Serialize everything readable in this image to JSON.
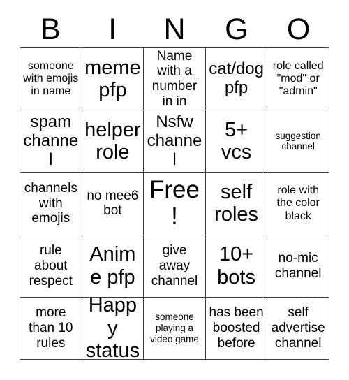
{
  "card": {
    "header_letters": [
      "B",
      "I",
      "N",
      "G",
      "O"
    ],
    "rows": [
      [
        {
          "text": "someone with emojis in name",
          "size": "s"
        },
        {
          "text": "meme pfp",
          "size": "xl"
        },
        {
          "text": "Name with a number in in",
          "size": "m"
        },
        {
          "text": "cat/dog pfp",
          "size": "l"
        },
        {
          "text": "role called \"mod\" or \"admin\"",
          "size": "s"
        }
      ],
      [
        {
          "text": "spam channel",
          "size": "l"
        },
        {
          "text": "helper role",
          "size": "xl"
        },
        {
          "text": "Nsfw channel",
          "size": "l"
        },
        {
          "text": "5+ vcs",
          "size": "xl"
        },
        {
          "text": "suggestion channel",
          "size": "xs"
        }
      ],
      [
        {
          "text": "channels with emojis",
          "size": "m"
        },
        {
          "text": "no mee6 bot",
          "size": "m"
        },
        {
          "text": "Free!",
          "size": "free"
        },
        {
          "text": "self roles",
          "size": "xl"
        },
        {
          "text": "role with the color black",
          "size": "s"
        }
      ],
      [
        {
          "text": "rule about respect",
          "size": "m"
        },
        {
          "text": "Anime pfp",
          "size": "xl"
        },
        {
          "text": "give away channel",
          "size": "m"
        },
        {
          "text": "10+ bots",
          "size": "xl"
        },
        {
          "text": "no-mic channel",
          "size": "m"
        }
      ],
      [
        {
          "text": "more than 10 rules",
          "size": "m"
        },
        {
          "text": "Happy status",
          "size": "xl"
        },
        {
          "text": "someone playing a video game",
          "size": "xs"
        },
        {
          "text": "has been boosted before",
          "size": "m"
        },
        {
          "text": "self advertise channel",
          "size": "m"
        }
      ]
    ]
  },
  "colors": {
    "background": "#ffffff",
    "border": "#3a3a3a",
    "text": "#000000"
  }
}
